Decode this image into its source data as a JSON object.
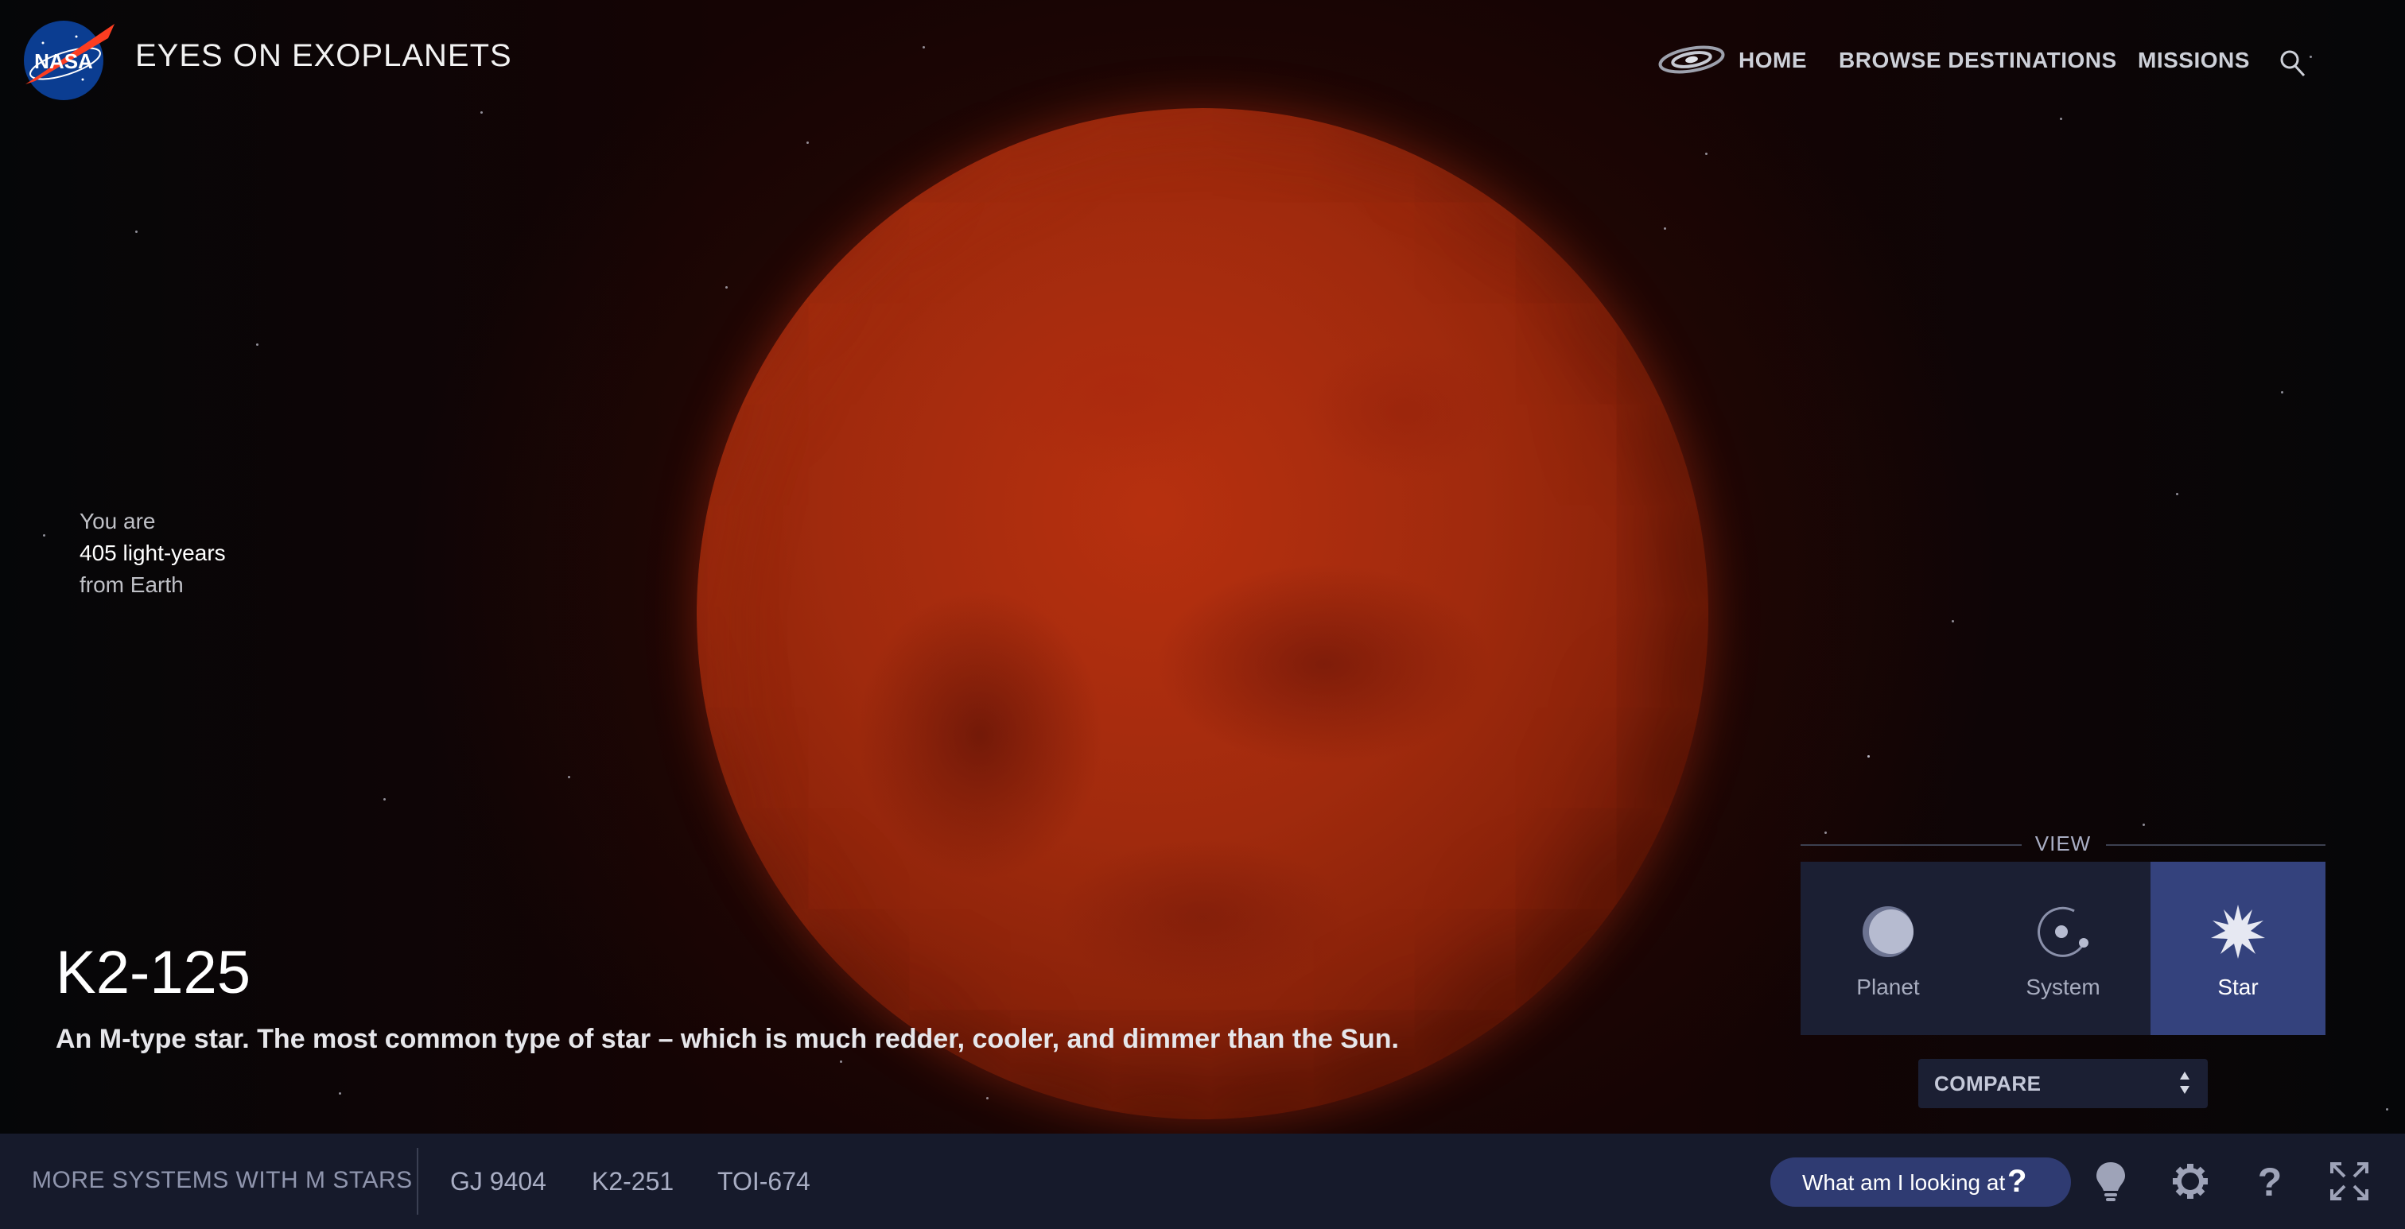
{
  "header": {
    "logo_text": "NASA",
    "title": "EYES ON EXOPLANETS",
    "nav": [
      {
        "label": "HOME",
        "icon": "galaxy-icon"
      },
      {
        "label": "BROWSE DESTINATIONS"
      },
      {
        "label": "MISSIONS"
      }
    ],
    "search_icon": "search-icon"
  },
  "distance": {
    "line1": "You are",
    "line2": "405 light-years",
    "line3": "from Earth"
  },
  "object": {
    "name": "K2-125",
    "description": "An M-type star. The most common type of star – which is much redder, cooler, and dimmer than the Sun."
  },
  "view": {
    "label": "VIEW",
    "options": [
      {
        "label": "Planet",
        "icon": "planet-icon"
      },
      {
        "label": "System",
        "icon": "system-icon"
      },
      {
        "label": "Star",
        "icon": "star-icon",
        "active": true
      }
    ],
    "compare_label": "COMPARE"
  },
  "bottombar": {
    "more_label": "MORE SYSTEMS WITH M STARS",
    "systems": [
      "GJ 9404",
      "K2-251",
      "TOI-674"
    ],
    "what_label": "What am I looking at",
    "what_q": "?",
    "icons": [
      "lightbulb-icon",
      "gear-icon",
      "help-icon",
      "fullscreen-icon"
    ]
  },
  "colors": {
    "accent": "#34427d",
    "panel": "#1b1f33",
    "bar": "#161a2b",
    "star_body": "#a02a0d"
  }
}
